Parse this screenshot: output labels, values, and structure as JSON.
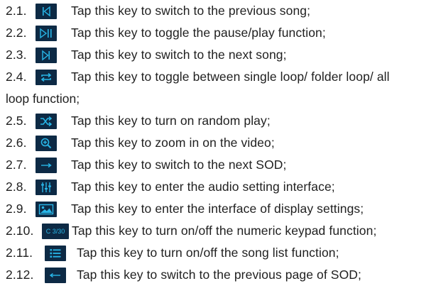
{
  "items": [
    {
      "num": "2.1.",
      "icon": "previous-song-icon",
      "text": "Tap this key to switch to the previous song;"
    },
    {
      "num": "2.2.",
      "icon": "play-pause-icon",
      "text": "Tap this key to toggle the pause/play function;"
    },
    {
      "num": "2.3.",
      "icon": "next-song-icon",
      "text": "Tap this key to switch to the next song;"
    },
    {
      "num": "2.4.",
      "icon": "loop-icon",
      "text": "Tap this key to toggle between single loop/ folder loop/ all",
      "continuation": "loop function;"
    },
    {
      "num": "2.5.",
      "icon": "shuffle-icon",
      "text": "Tap this key to turn on random play;"
    },
    {
      "num": "2.6.",
      "icon": "zoom-in-icon",
      "text": "Tap this key to zoom in on the video;"
    },
    {
      "num": "2.7.",
      "icon": "next-sod-icon",
      "text": "Tap this key to switch to the next SOD;"
    },
    {
      "num": "2.8.",
      "icon": "audio-settings-icon",
      "text": "Tap this key to enter the audio setting interface;"
    },
    {
      "num": "2.9.",
      "icon": "display-settings-icon",
      "text": "Tap this key to enter the interface of display settings;"
    },
    {
      "num": "2.10.",
      "icon": "numeric-keypad-icon",
      "icon_text": "C 3/30",
      "text": "Tap this key to turn on/off the numeric keypad function;"
    },
    {
      "num": "2.11.",
      "icon": "song-list-icon",
      "text": "Tap this key to turn on/off the song list function;"
    },
    {
      "num": "2.12.",
      "icon": "previous-sod-page-icon",
      "text": "Tap this key to switch to the previous page of SOD;"
    }
  ],
  "colors": {
    "icon_bg": "#0d2a45",
    "icon_fg": "#28b6e8",
    "text": "#1f1f1f"
  }
}
